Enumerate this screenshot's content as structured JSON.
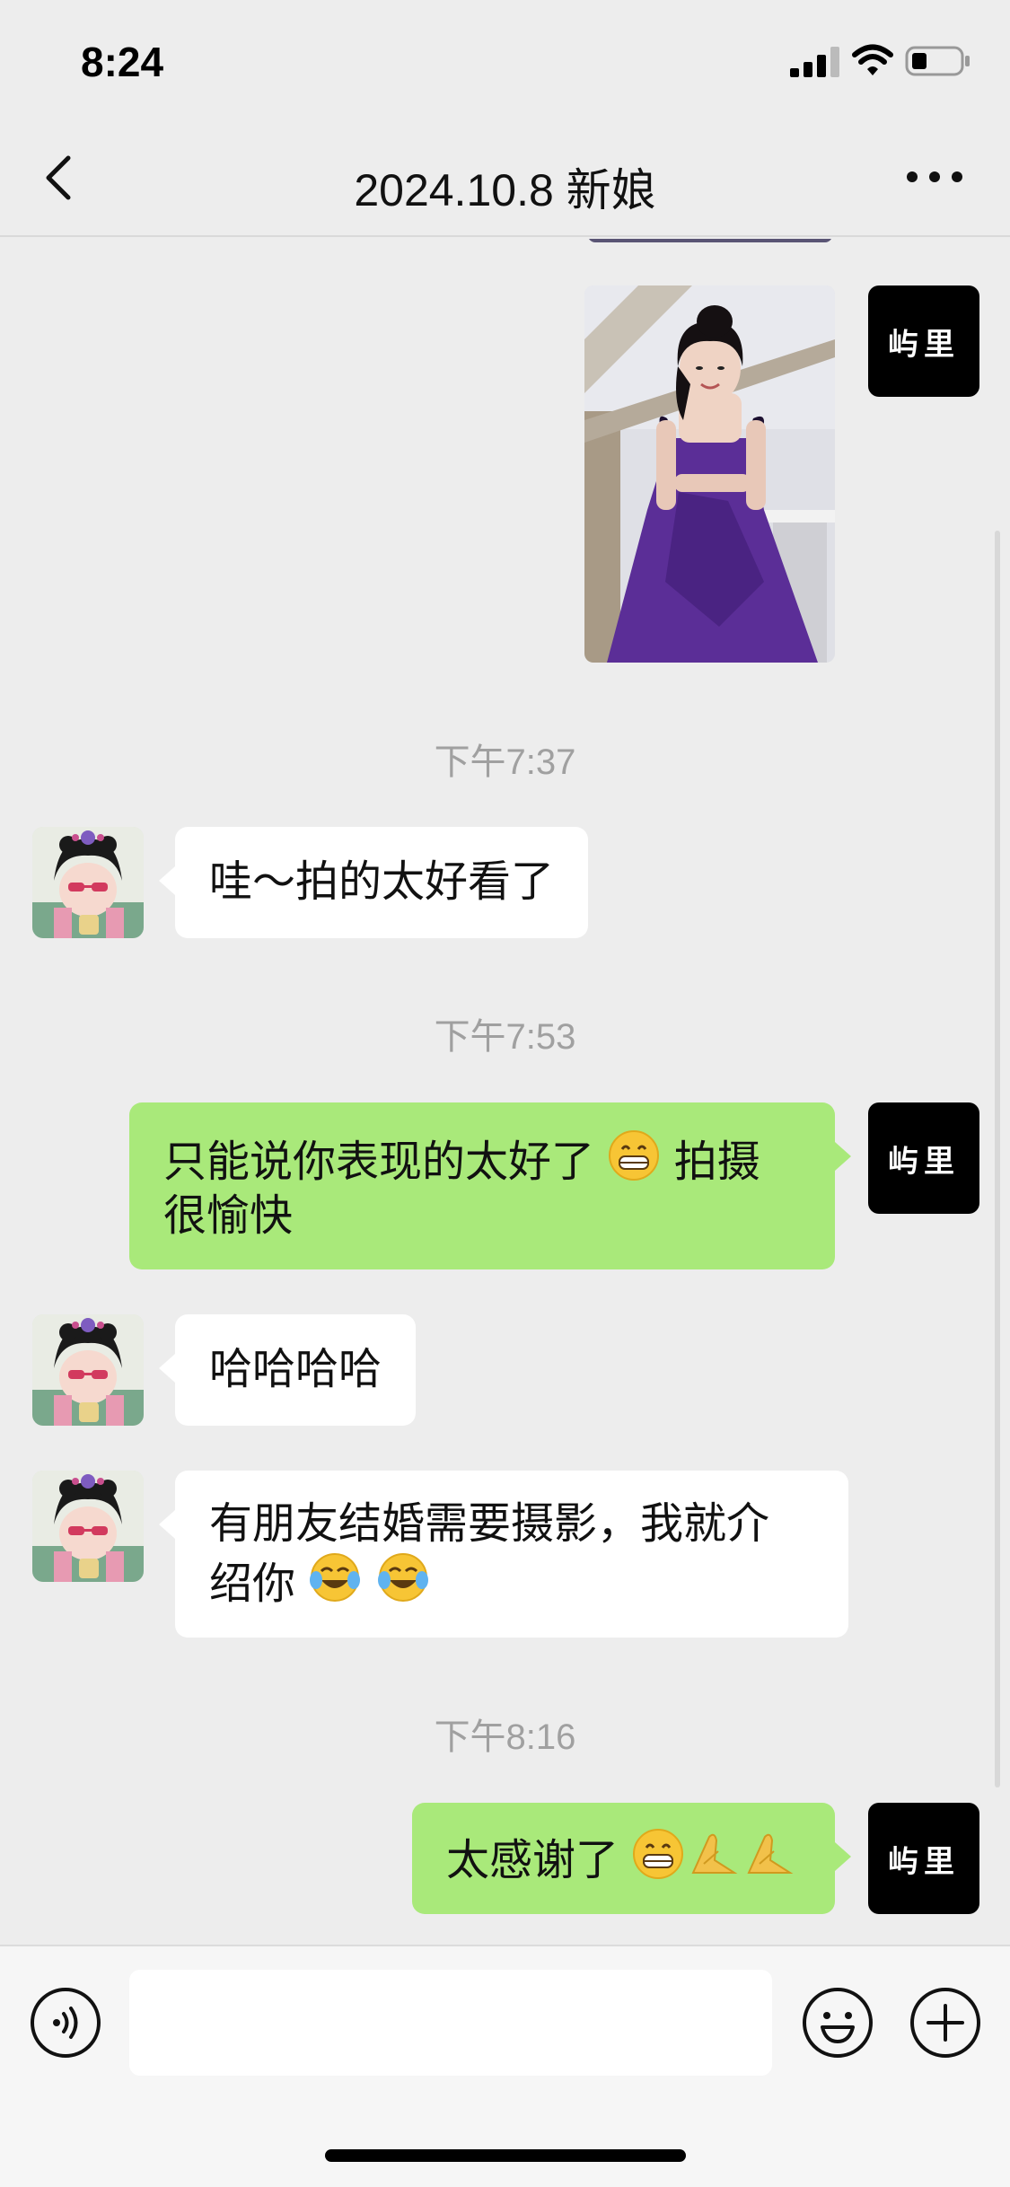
{
  "status_bar": {
    "time": "8:24"
  },
  "nav": {
    "title": "2024.10.8 新娘",
    "back_icon": "chevron-left-icon",
    "more_icon": "more-dots-icon"
  },
  "brand_avatar_text": "屿里",
  "messages": [
    {
      "type": "image",
      "from": "me",
      "icon": "photo-bride-purple-gown"
    },
    {
      "type": "time",
      "text": "下午7:37"
    },
    {
      "type": "text",
      "from": "other",
      "text": "哇～拍的太好看了"
    },
    {
      "type": "time",
      "text": "下午7:53"
    },
    {
      "type": "text",
      "from": "me",
      "line1": "只能说你表现的太好了",
      "line1_after": " 拍摄",
      "line2": "很愉快"
    },
    {
      "type": "text",
      "from": "other",
      "text": "哈哈哈哈"
    },
    {
      "type": "text",
      "from": "other",
      "line1": "有朋友结婚需要摄影，我就介",
      "line2": "绍你"
    },
    {
      "type": "time",
      "text": "下午8:16"
    },
    {
      "type": "text",
      "from": "me",
      "text": "太感谢了"
    }
  ],
  "colors": {
    "background": "#ededed",
    "outgoing_bubble": "#a9e97a",
    "incoming_bubble": "#ffffff",
    "timestamp": "#a0a0a0"
  },
  "input_bar": {
    "voice_icon": "voice-icon",
    "emoji_icon": "emoji-icon",
    "plus_icon": "plus-icon",
    "value": ""
  }
}
